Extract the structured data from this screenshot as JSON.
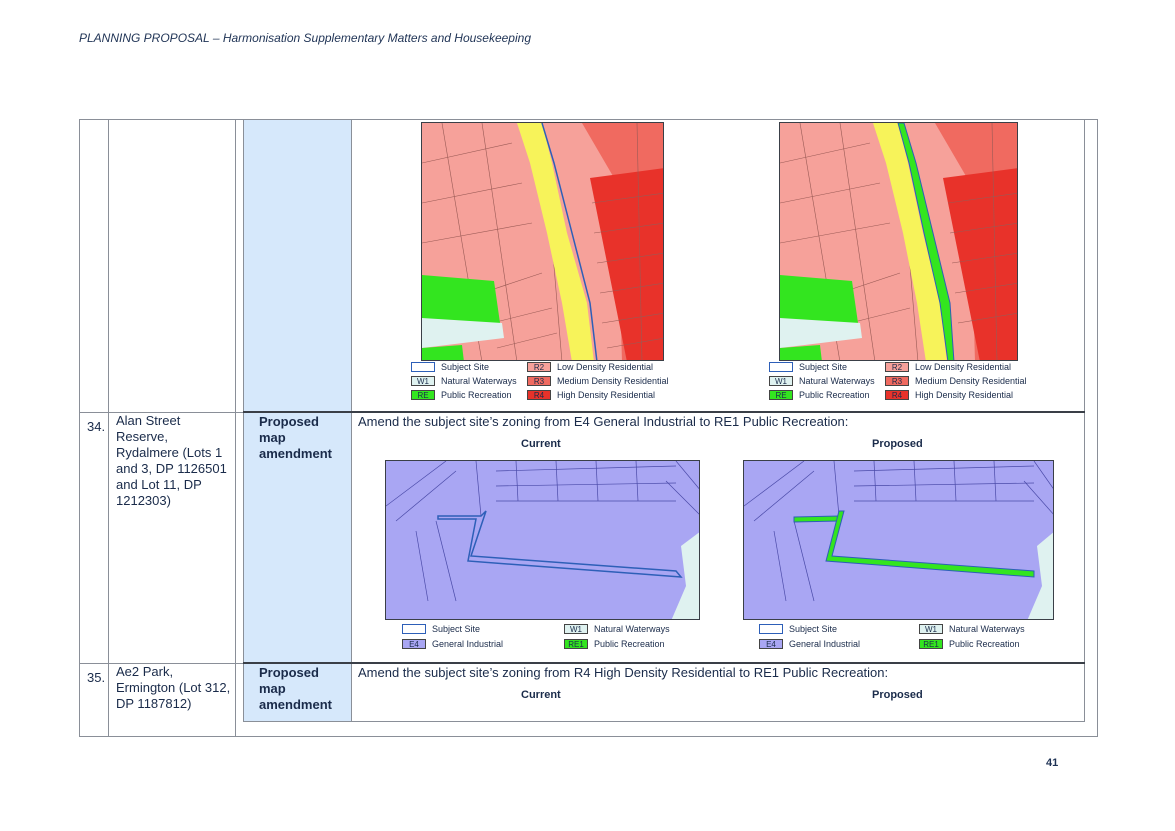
{
  "header": {
    "title": "PLANNING PROPOSAL – Harmonisation Supplementary Matters and Housekeeping"
  },
  "page_number": "41",
  "legend_top": {
    "subject": "Subject Site",
    "w1_code": "W1",
    "w1_label": "Natural Waterways",
    "re_code": "RE",
    "re_label": "Public Recreation",
    "r2_code": "R2",
    "r2_label": "Low Density Residential",
    "r3_code": "R3",
    "r3_label": "Medium Density Residential",
    "r4_code": "R4",
    "r4_label": "High Density Residential"
  },
  "legend_mid": {
    "subject": "Subject Site",
    "e4_code": "E4",
    "e4_label": "General Industrial",
    "w1_code": "W1",
    "w1_label": "Natural Waterways",
    "re1_code": "RE1",
    "re1_label": "Public Recreation"
  },
  "rows": [
    {
      "number": "34.",
      "site": "Alan Street Reserve, Rydalmere (Lots 1 and 3, DP 1126501 and Lot 11, DP 1212303)",
      "type": "Proposed map amendment",
      "amendment": "Amend the subject site’s zoning from E4 General Industrial to RE1 Public Recreation:",
      "current_label": "Current",
      "proposed_label": "Proposed"
    },
    {
      "number": "35.",
      "site": "Ae2 Park, Ermington (Lot 312, DP 1187812)",
      "type": "Proposed map amendment",
      "amendment": "Amend the subject site’s zoning from R4 High Density Residential to RE1 Public Recreation:",
      "current_label": "Current",
      "proposed_label": "Proposed"
    }
  ],
  "colors": {
    "r2": "#f6a19a",
    "r4": "#e8322a",
    "sp2": "#f7f35a",
    "re": "#33e51f",
    "w1": "#dff2f0",
    "e4": "#a9a6f3",
    "cell_blue": "#d6e8fb"
  }
}
